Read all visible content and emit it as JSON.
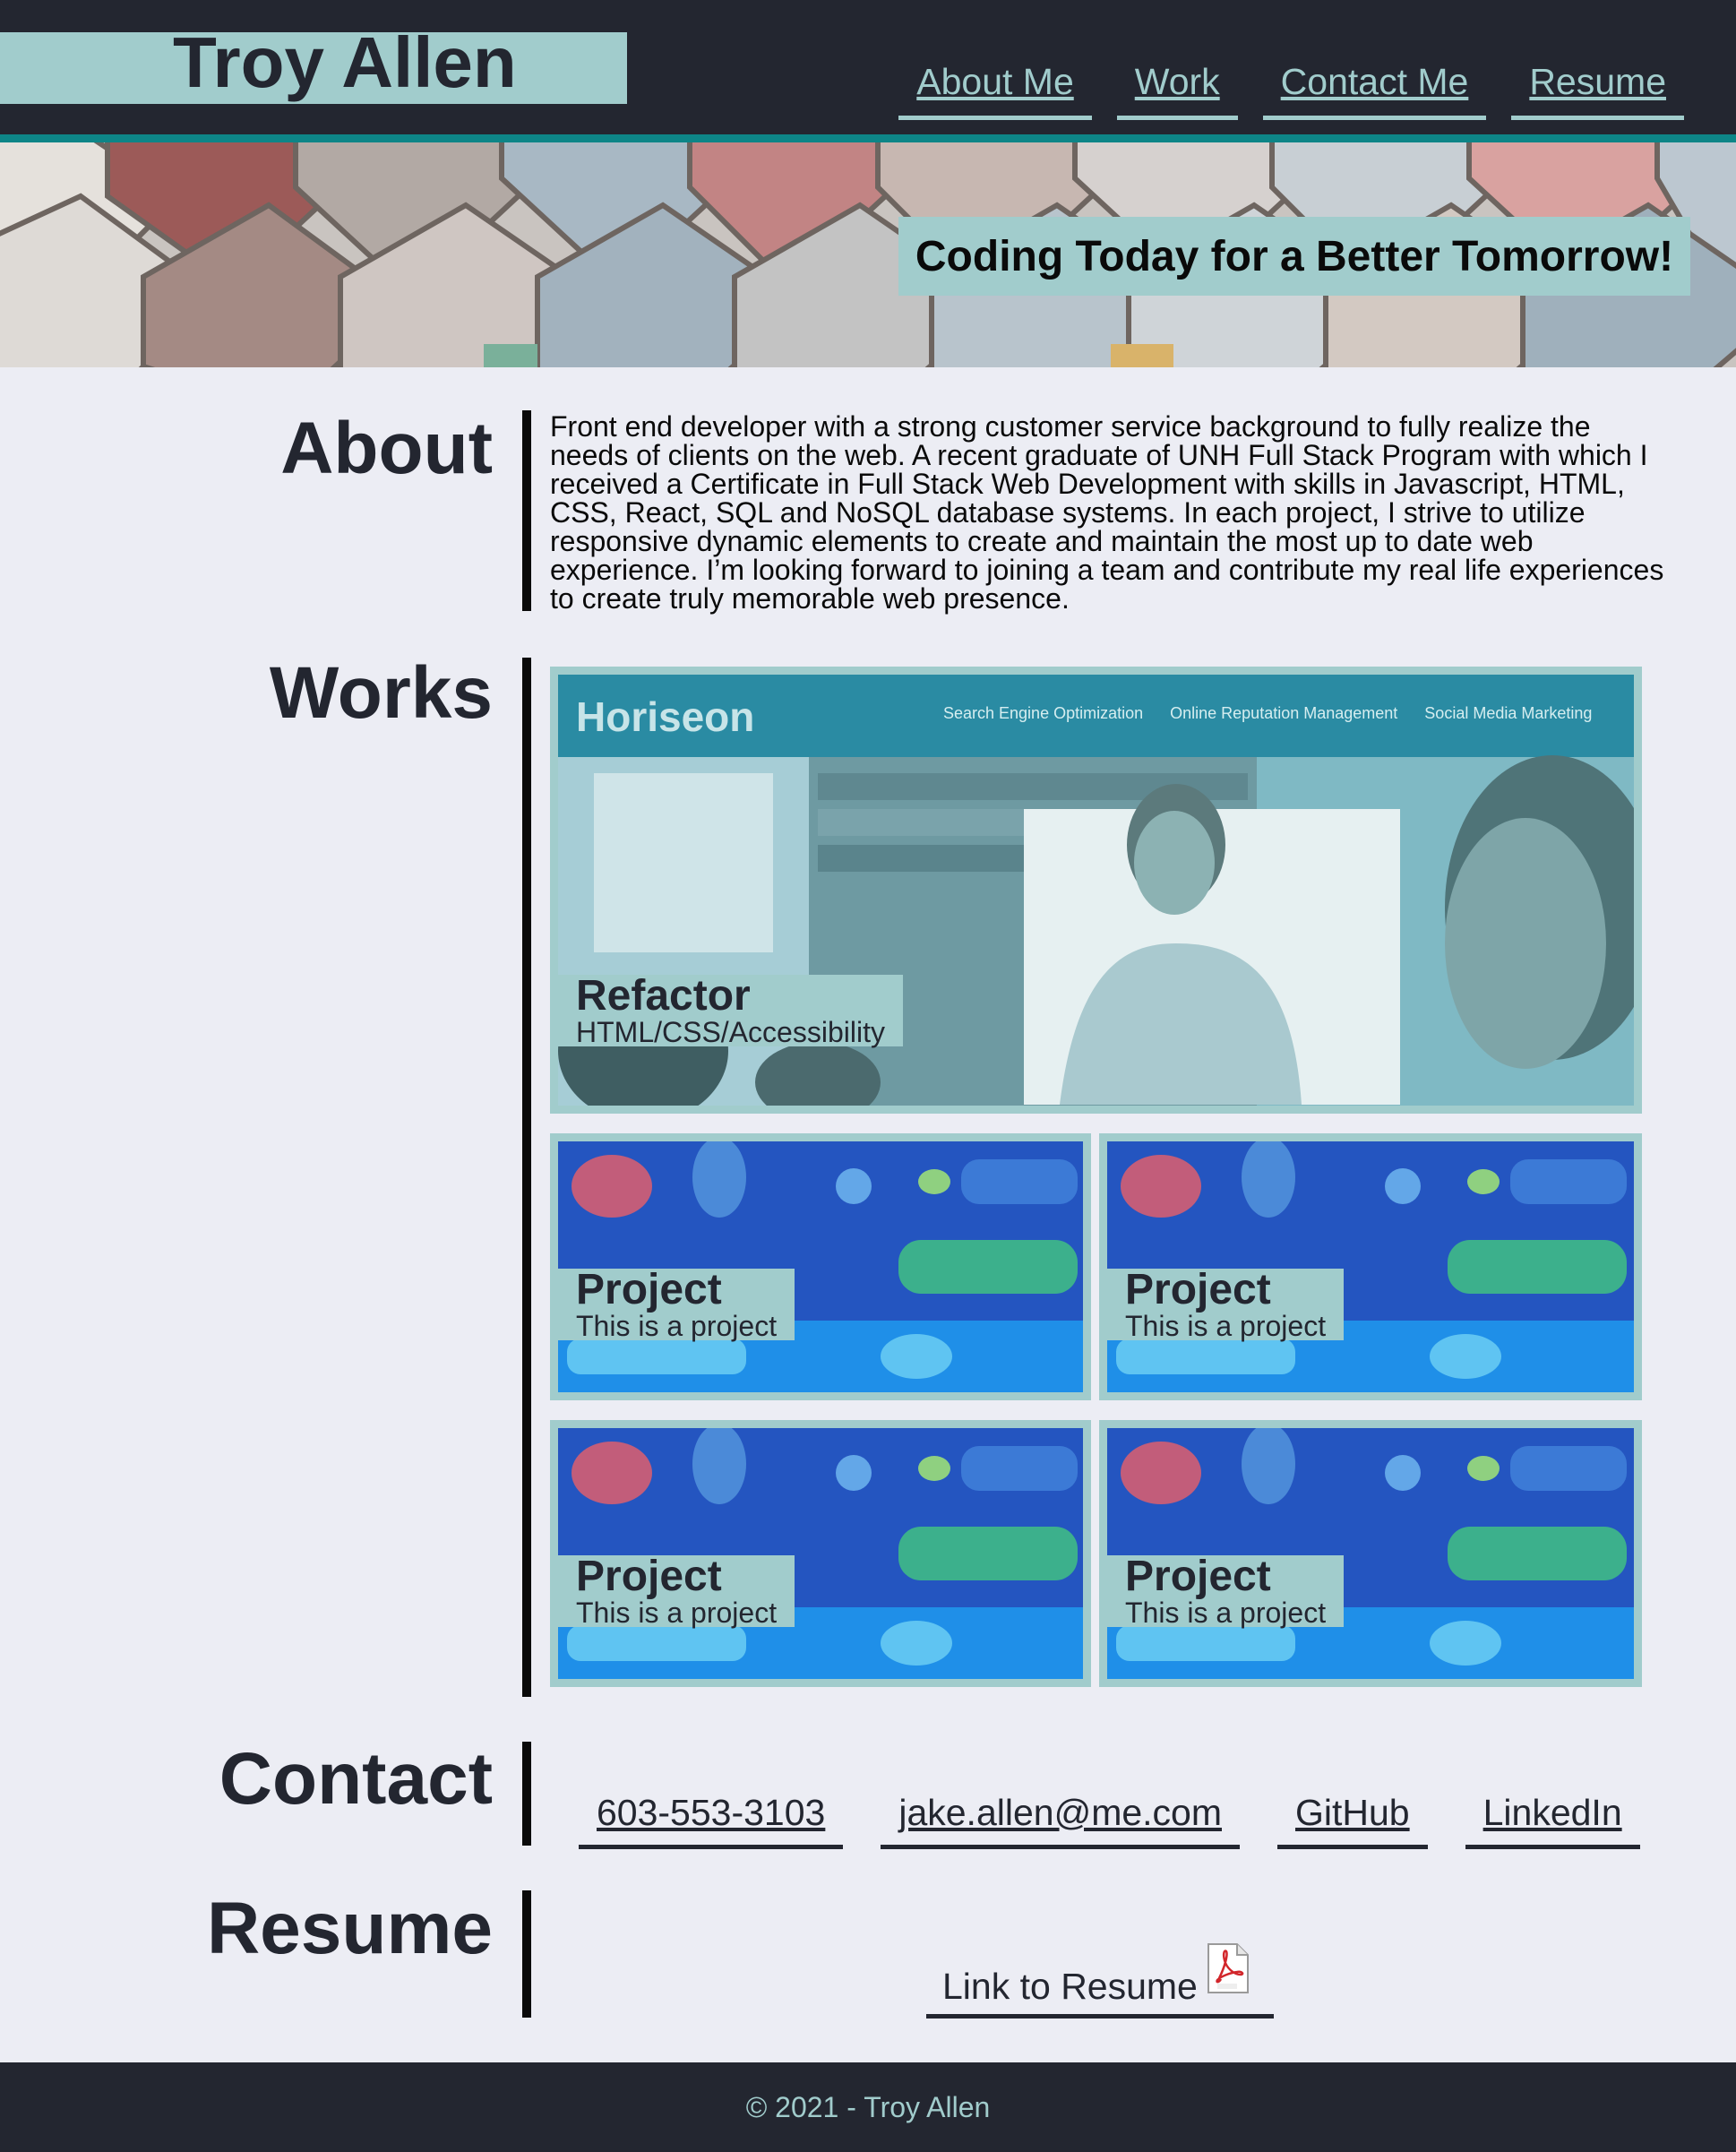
{
  "header": {
    "name": "Troy Allen",
    "nav": [
      {
        "label": "About Me"
      },
      {
        "label": "Work"
      },
      {
        "label": "Contact Me"
      },
      {
        "label": "Resume"
      }
    ]
  },
  "hero": {
    "tagline": "Coding Today for a Better Tomorrow!"
  },
  "about": {
    "title": "About",
    "text": "Front end developer with a strong customer service background to fully realize the needs of clients on the web. A recent graduate of UNH Full Stack Program with which I received a Certificate in Full Stack Web Development with skills in Javascript, HTML, CSS, React, SQL and NoSQL database systems. In each project, I strive to utilize responsive dynamic elements to create and maintain the most up to date web experience. I’m looking forward to joining a team and contribute my real life experiences to create truly memorable web presence."
  },
  "works": {
    "title": "Works",
    "featured": {
      "title": "Refactor",
      "subtitle": "HTML/CSS/Accessibility",
      "preview": {
        "brand": "Horiseon",
        "links": [
          "Search Engine Optimization",
          "Online Reputation Management",
          "Social Media Marketing"
        ]
      }
    },
    "projects": [
      {
        "title": "Project",
        "subtitle": "This is a project"
      },
      {
        "title": "Project",
        "subtitle": "This is a project"
      },
      {
        "title": "Project",
        "subtitle": "This is a project"
      },
      {
        "title": "Project",
        "subtitle": "This is a project"
      }
    ]
  },
  "contact": {
    "title": "Contact",
    "links": [
      {
        "label": "603-553-3103"
      },
      {
        "label": "jake.allen@me.com"
      },
      {
        "label": "GitHub"
      },
      {
        "label": "LinkedIn"
      }
    ]
  },
  "resume": {
    "title": "Resume",
    "link_label": "Link to Resume",
    "icon": "pdf-icon"
  },
  "footer": {
    "text": "© 2021 - Troy Allen"
  },
  "colors": {
    "dark": "#232630",
    "accent": "#a1cccc",
    "teal_stripe": "#0d8587",
    "background": "#ecedf4"
  }
}
